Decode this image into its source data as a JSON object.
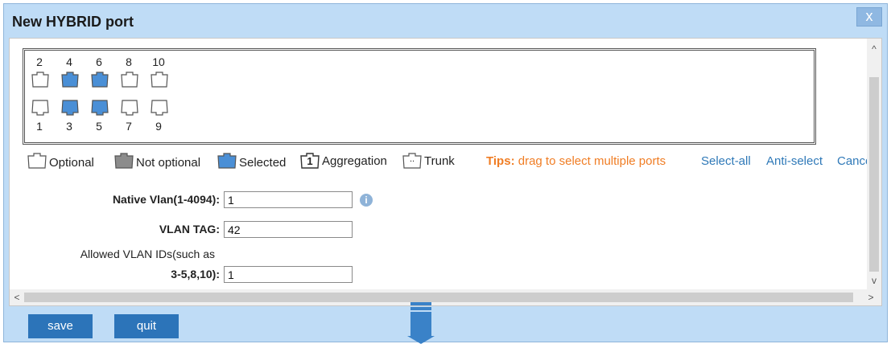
{
  "dialog": {
    "title": "New HYBRID port",
    "close_label": "x"
  },
  "ports": {
    "top_numbers": [
      "2",
      "4",
      "6",
      "8",
      "10"
    ],
    "bottom_numbers": [
      "1",
      "3",
      "5",
      "7",
      "9"
    ],
    "selected": [
      "3",
      "4",
      "5",
      "6"
    ],
    "colors": {
      "optional": "#ffffff",
      "not_optional": "#8c8c8c",
      "selected": "#4a8fd6",
      "outline": "#555555"
    }
  },
  "legend": {
    "optional": "Optional",
    "not_optional": "Not optional",
    "selected": "Selected",
    "aggregation_icon_text": "1",
    "aggregation": "Aggregation",
    "trunk_icon_text": "..",
    "trunk": "Trunk",
    "tips_label": "Tips:",
    "tips_text": "drag to select multiple ports",
    "select_all": "Select-all",
    "anti_select": "Anti-select",
    "cancel": "Cance"
  },
  "form": {
    "native_vlan_label": "Native Vlan(1-4094):",
    "native_vlan_value": "1",
    "info_icon_text": "i",
    "vlan_tag_label": "VLAN TAG:",
    "vlan_tag_value": "42",
    "allowed_label_line1": "Allowed VLAN IDs(such as",
    "allowed_label_line2": "3-5,8,10):",
    "allowed_value": "1"
  },
  "scrollbars": {
    "up": "^",
    "down": "v",
    "left": "<",
    "right": ">"
  },
  "buttons": {
    "save": "save",
    "quit": "quit"
  }
}
